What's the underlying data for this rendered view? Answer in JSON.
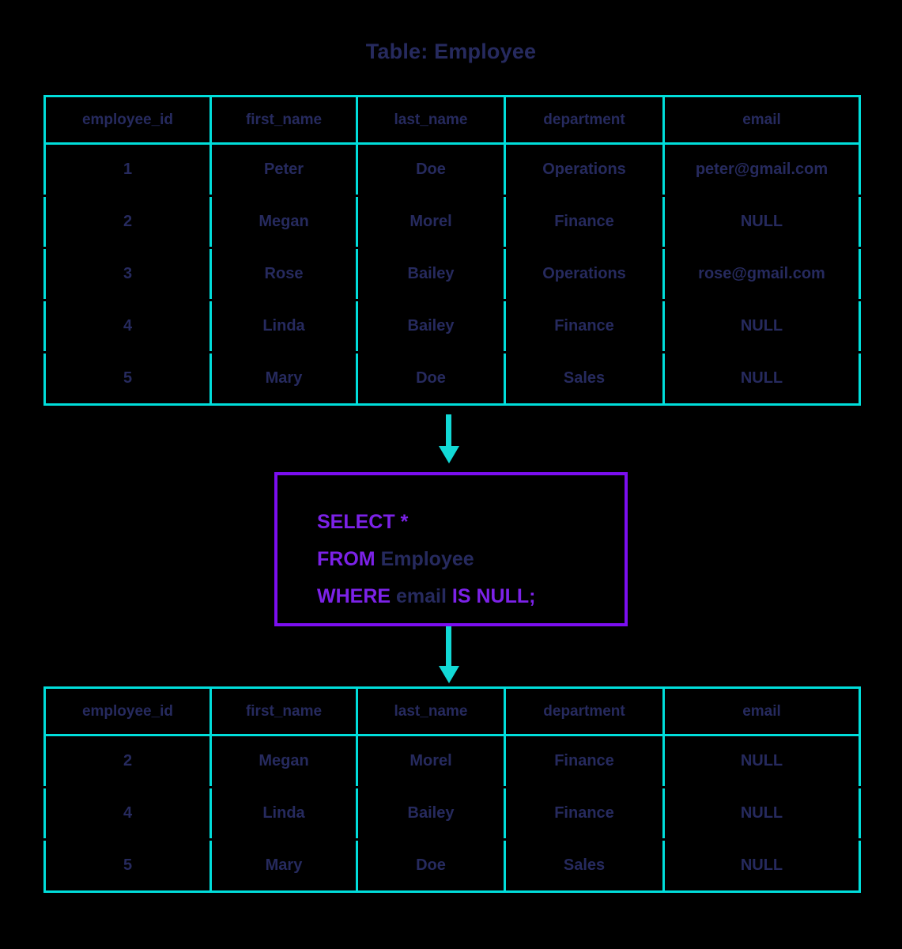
{
  "title": "Table: Employee",
  "colors": {
    "background": "#000000",
    "table_border": "#00dedb",
    "arrow": "#12d9d6",
    "query_border": "#7b0ef0",
    "keyword": "#7c22e8",
    "identifier": "#262a5e",
    "text": "#262a5e"
  },
  "source_table": {
    "name": "Employee",
    "columns": [
      "employee_id",
      "first_name",
      "last_name",
      "department",
      "email"
    ],
    "rows": [
      [
        "1",
        "Peter",
        "Doe",
        "Operations",
        "peter@gmail.com"
      ],
      [
        "2",
        "Megan",
        "Morel",
        "Finance",
        "NULL"
      ],
      [
        "3",
        "Rose",
        "Bailey",
        "Operations",
        "rose@gmail.com"
      ],
      [
        "4",
        "Linda",
        "Bailey",
        "Finance",
        "NULL"
      ],
      [
        "5",
        "Mary",
        "Doe",
        "Sales",
        "NULL"
      ]
    ]
  },
  "query": {
    "line1": [
      {
        "text": "SELECT",
        "type": "keyword"
      },
      {
        "text": " ",
        "type": "space"
      },
      {
        "text": "*",
        "type": "keyword"
      }
    ],
    "line2": [
      {
        "text": "FROM",
        "type": "keyword"
      },
      {
        "text": " ",
        "type": "space"
      },
      {
        "text": "Employee",
        "type": "identifier"
      }
    ],
    "line3": [
      {
        "text": "WHERE",
        "type": "keyword"
      },
      {
        "text": " ",
        "type": "space"
      },
      {
        "text": "email",
        "type": "identifier"
      },
      {
        "text": " ",
        "type": "space"
      },
      {
        "text": "IS NULL",
        "type": "keyword"
      },
      {
        "text": ";",
        "type": "keyword"
      }
    ],
    "full_text": "SELECT * FROM Employee WHERE email IS NULL;"
  },
  "result_table": {
    "columns": [
      "employee_id",
      "first_name",
      "last_name",
      "department",
      "email"
    ],
    "rows": [
      [
        "2",
        "Megan",
        "Morel",
        "Finance",
        "NULL"
      ],
      [
        "4",
        "Linda",
        "Bailey",
        "Finance",
        "NULL"
      ],
      [
        "5",
        "Mary",
        "Doe",
        "Sales",
        "NULL"
      ]
    ]
  },
  "arrows": [
    {
      "name": "arrow-table-to-query",
      "direction": "down"
    },
    {
      "name": "arrow-query-to-result",
      "direction": "down"
    }
  ]
}
